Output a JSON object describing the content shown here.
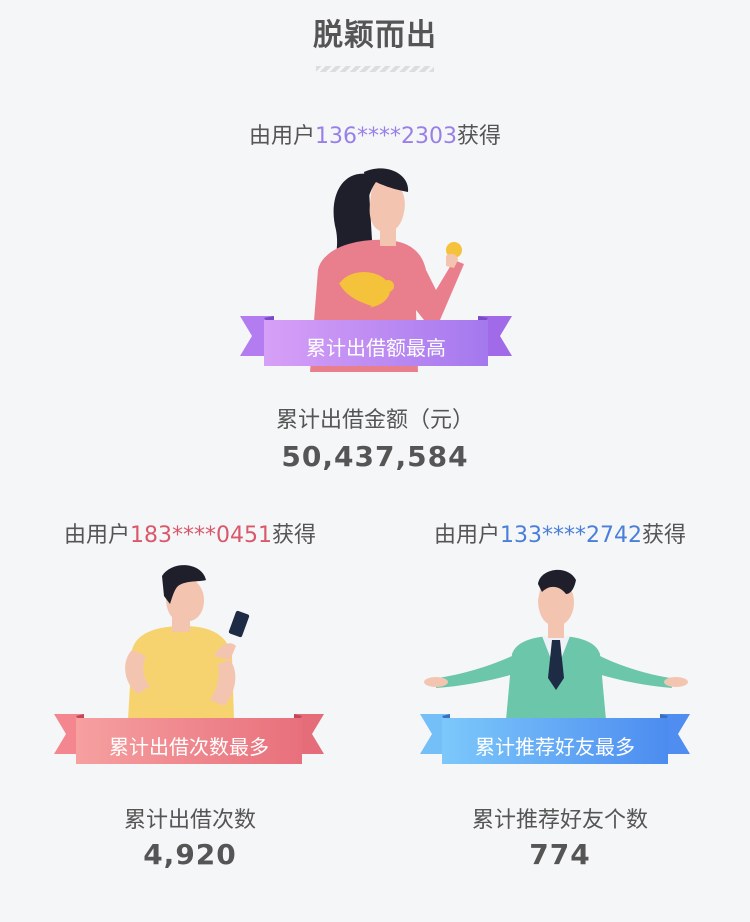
{
  "title": "脱颖而出",
  "awards": {
    "top": {
      "prefix": "由用户",
      "phone": "136****2303",
      "suffix": "获得",
      "phone_color": "#9a80e6",
      "ribbon": "累计出借额最高",
      "metric_label": "累计出借金额（元）",
      "metric_value": "50,437,584"
    },
    "left": {
      "prefix": "由用户",
      "phone": "183****0451",
      "suffix": "获得",
      "phone_color": "#d9596a",
      "ribbon": "累计出借次数最多",
      "metric_label": "累计出借次数",
      "metric_value": "4,920"
    },
    "right": {
      "prefix": "由用户",
      "phone": "133****2742",
      "suffix": "获得",
      "phone_color": "#4a7fd9",
      "ribbon": "累计推荐好友最多",
      "metric_label": "累计推荐好友个数",
      "metric_value": "774"
    }
  }
}
